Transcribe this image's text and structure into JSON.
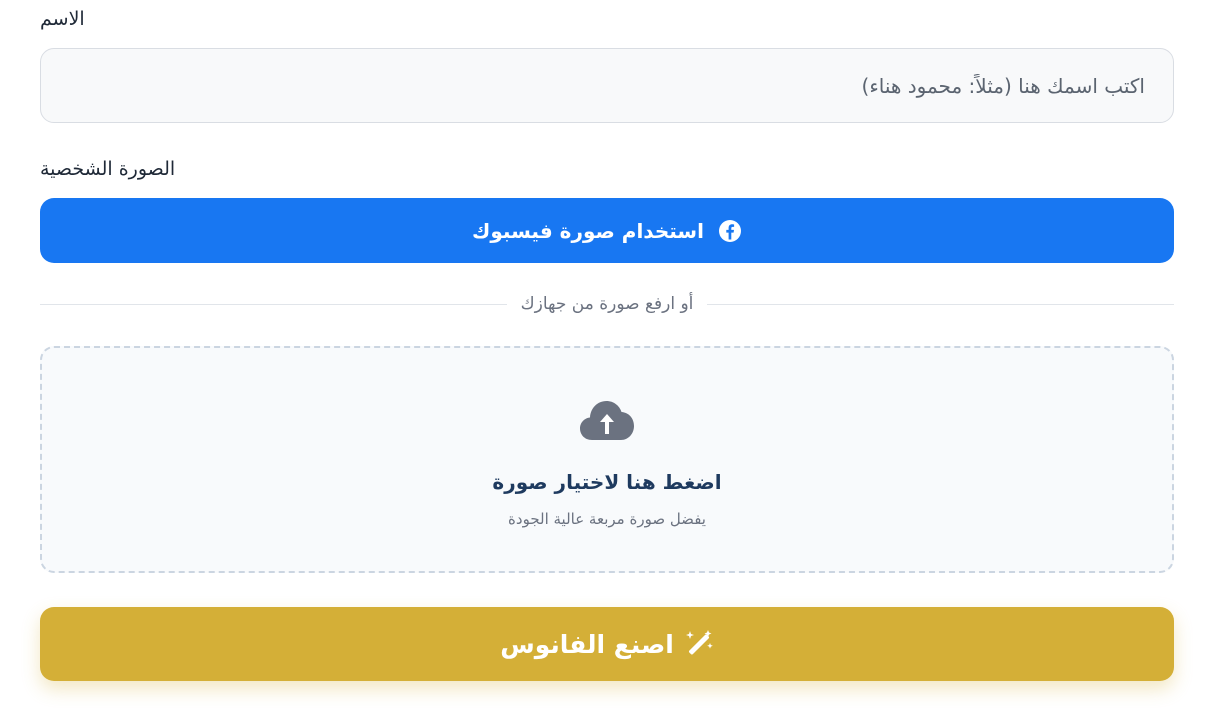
{
  "form": {
    "name_label": "الاسم",
    "name_placeholder": "اكتب اسمك هنا (مثلاً: محمود هناء)",
    "name_value": "",
    "photo_label": "الصورة الشخصية",
    "facebook_button_label": "استخدام صورة فيسبوك",
    "divider_text": "أو ارفع صورة من جهازك",
    "upload": {
      "title": "اضغط هنا لاختيار صورة",
      "subtitle": "يفضل صورة مربعة عالية الجودة",
      "icon": "cloud-upload-icon"
    },
    "submit_label": "اصنع الفانوس",
    "icons": {
      "facebook": "facebook-icon",
      "submit": "magic-wand-icon"
    }
  },
  "colors": {
    "facebook_blue": "#1877f2",
    "gold": "#d4af37",
    "upload_title": "#1e3a5f",
    "text": "#1f2937",
    "muted": "#6b7280"
  }
}
